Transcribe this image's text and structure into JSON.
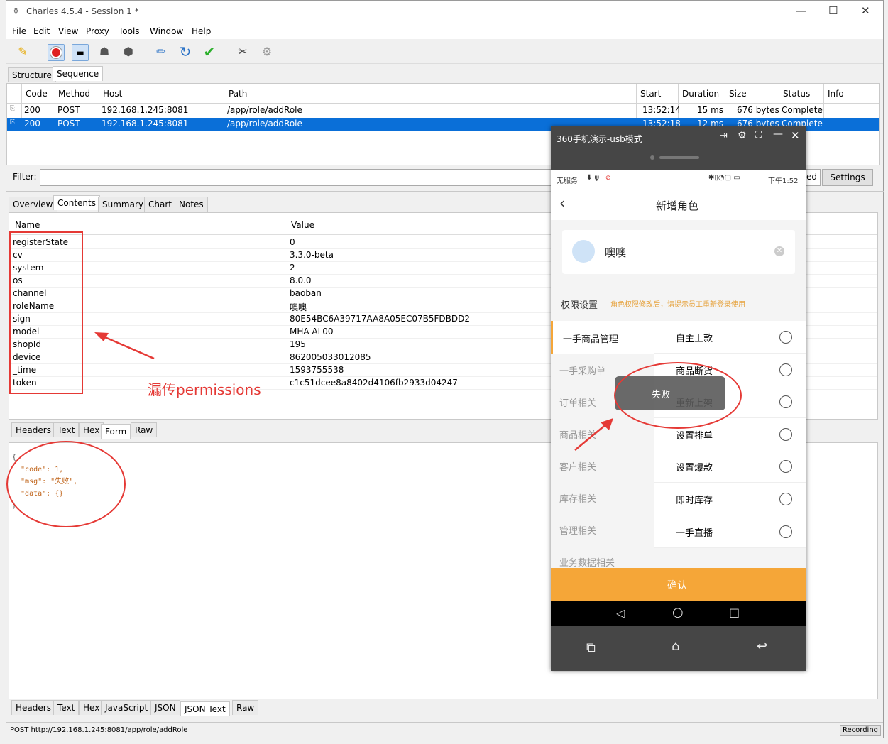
{
  "window": {
    "title": "Charles 4.5.4 - Session 1 *",
    "controls": {
      "minimize": "—",
      "maximize": "☐",
      "close": "✕"
    }
  },
  "menu": [
    "File",
    "Edit",
    "View",
    "Proxy",
    "Tools",
    "Window",
    "Help"
  ],
  "toolbar_icons": [
    "broom-icon",
    "record-icon",
    "throttle-icon",
    "turtle-icon",
    "stop-icon",
    "pen-icon",
    "refresh-icon",
    "check-icon",
    "tools-icon",
    "gear-icon"
  ],
  "view_tabs": {
    "structure": "Structure",
    "sequence": "Sequence"
  },
  "sequence_table": {
    "columns": [
      "Code",
      "Method",
      "Host",
      "Path",
      "Start",
      "Duration",
      "Size",
      "Status",
      "Info"
    ],
    "rows": [
      {
        "code": "200",
        "method": "POST",
        "host": "192.168.1.245:8081",
        "path": "/app/role/addRole",
        "start": "13:52:14",
        "duration": "15 ms",
        "size": "676 bytes",
        "status": "Complete",
        "info": ""
      },
      {
        "code": "200",
        "method": "POST",
        "host": "192.168.1.245:8081",
        "path": "/app/role/addRole",
        "start": "13:52:18",
        "duration": "12 ms",
        "size": "676 bytes",
        "status": "Complete",
        "info": ""
      }
    ]
  },
  "filter": {
    "label": "Filter:",
    "value": "",
    "focused_suffix": "ed",
    "settings_button": "Settings"
  },
  "detail_tabs": [
    "Overview",
    "Contents",
    "Summary",
    "Chart",
    "Notes"
  ],
  "form_table": {
    "columns": [
      "Name",
      "Value"
    ],
    "rows": [
      {
        "name": "registerState",
        "value": "0"
      },
      {
        "name": "cv",
        "value": "3.3.0-beta"
      },
      {
        "name": "system",
        "value": "2"
      },
      {
        "name": "os",
        "value": "8.0.0"
      },
      {
        "name": "channel",
        "value": "baoban"
      },
      {
        "name": "roleName",
        "value": "噢噢"
      },
      {
        "name": "sign",
        "value": "80E54BC6A39717AA8A05EC07B5FDBDD2"
      },
      {
        "name": "model",
        "value": "MHA-AL00"
      },
      {
        "name": "shopId",
        "value": "195"
      },
      {
        "name": "device",
        "value": "862005033012085"
      },
      {
        "name": "_time",
        "value": "1593755538"
      },
      {
        "name": "token",
        "value": "c1c51dcee8a8402d4106fb2933d04247"
      }
    ]
  },
  "annotation_text": "漏传permissions",
  "request_tabs": [
    "Headers",
    "Text",
    "Hex",
    "Form",
    "Raw"
  ],
  "response_json": [
    "{",
    "  \"code\": 1,",
    "  \"msg\": \"失败\",",
    "  \"data\": {}",
    "}"
  ],
  "response_tabs": [
    "Headers",
    "Text",
    "Hex",
    "JavaScript",
    "JSON",
    "JSON Text",
    "Raw"
  ],
  "statusbar": {
    "url": "POST http://192.168.1.245:8081/app/role/addRole",
    "recording": "Recording"
  },
  "phone": {
    "window_title": "360手机演示-usb模式",
    "statusbar_left": "无服务",
    "statusbar_right": "下午1:52",
    "page_title": "新增角色",
    "role_name": "噢噢",
    "perm_title": "权限设置",
    "perm_hint": "角色权限修改后，请提示员工重新登录使用",
    "categories": [
      "一手商品管理",
      "一手采购单",
      "订单相关",
      "商品相关",
      "客户相关",
      "库存相关",
      "管理相关",
      "业务数据相关"
    ],
    "permissions": [
      "自主上款",
      "商品断货",
      "重新上架",
      "设置排单",
      "设置爆款",
      "即时库存",
      "一手直播"
    ],
    "toast": "失败",
    "confirm": "确认"
  },
  "colors": {
    "selection": "#0a6fd8",
    "annotation": "#e53935",
    "confirm": "#f5a638",
    "hint": "#e6a23c"
  }
}
